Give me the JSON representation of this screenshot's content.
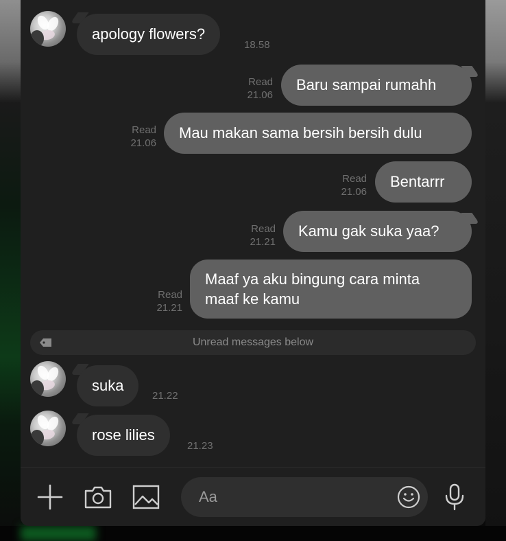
{
  "messages": {
    "m1": {
      "text": "apology flowers?",
      "time": "18.58"
    },
    "m2": {
      "text": "Baru sampai rumahh",
      "status": "Read",
      "time": "21.06"
    },
    "m3": {
      "text": "Mau makan sama bersih bersih dulu",
      "status": "Read",
      "time": "21.06"
    },
    "m4": {
      "text": "Bentarrr",
      "status": "Read",
      "time": "21.06"
    },
    "m5": {
      "text": "Kamu gak suka yaa?",
      "status": "Read",
      "time": "21.21"
    },
    "m6": {
      "line1": "Maaf ya aku bingung cara minta",
      "line2": "maaf ke kamu",
      "status": "Read",
      "time": "21.21"
    },
    "m7": {
      "text": "suka",
      "time": "21.22"
    },
    "m8": {
      "text": "rose lilies",
      "time": "21.23"
    }
  },
  "unread_divider": {
    "label": "Unread messages below"
  },
  "composer": {
    "placeholder": "Aa"
  },
  "icons": [
    "plus-icon",
    "camera-icon",
    "image-icon",
    "emoji-icon",
    "microphone-icon",
    "tag-icon"
  ],
  "colors": {
    "incoming_bubble": "#2f2f2f",
    "outgoing_bubble": "#606060",
    "panel": "#1f1f1f",
    "meta_text": "#6f6f6f"
  }
}
